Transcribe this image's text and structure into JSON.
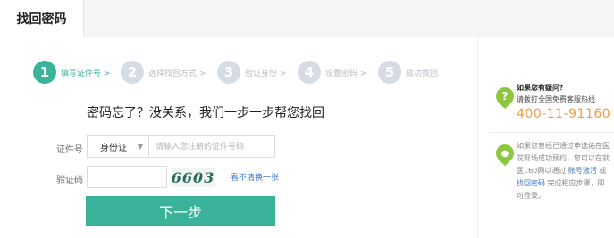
{
  "tabs": {
    "active": "找回密码"
  },
  "steps": [
    {
      "num": "1",
      "label": "填写证件号 >"
    },
    {
      "num": "2",
      "label": "选择找回方式 >"
    },
    {
      "num": "3",
      "label": "验证身份 >"
    },
    {
      "num": "4",
      "label": "设置密码 >"
    },
    {
      "num": "5",
      "label": "成功找回"
    }
  ],
  "main": {
    "headline": "密码忘了？没关系，我们一步一步帮您找回",
    "id_label": "证件号",
    "id_type": "身份证",
    "id_placeholder": "请输入您注册的证件号码",
    "captcha_label": "验证码",
    "captcha_text": "6603",
    "refresh_label": "看不清换一张",
    "next_label": "下一步"
  },
  "help": {
    "title": "如果您有疑问？",
    "sub": "请拨打全国免费客服热线",
    "phone": "400-11-91160",
    "note_pre": "如果您曾经已通过申选佑在医院现场成功预约，您可以在就医160网以通过",
    "note_link1": "账号激活",
    "note_mid": "或",
    "note_link2": "找回密码",
    "note_post": "完成相应步骤，即可登录。"
  },
  "colors": {
    "accent": "#3bb39a",
    "phone": "#f29b40",
    "link": "#3a76c4",
    "pin": "#8dc63f"
  }
}
